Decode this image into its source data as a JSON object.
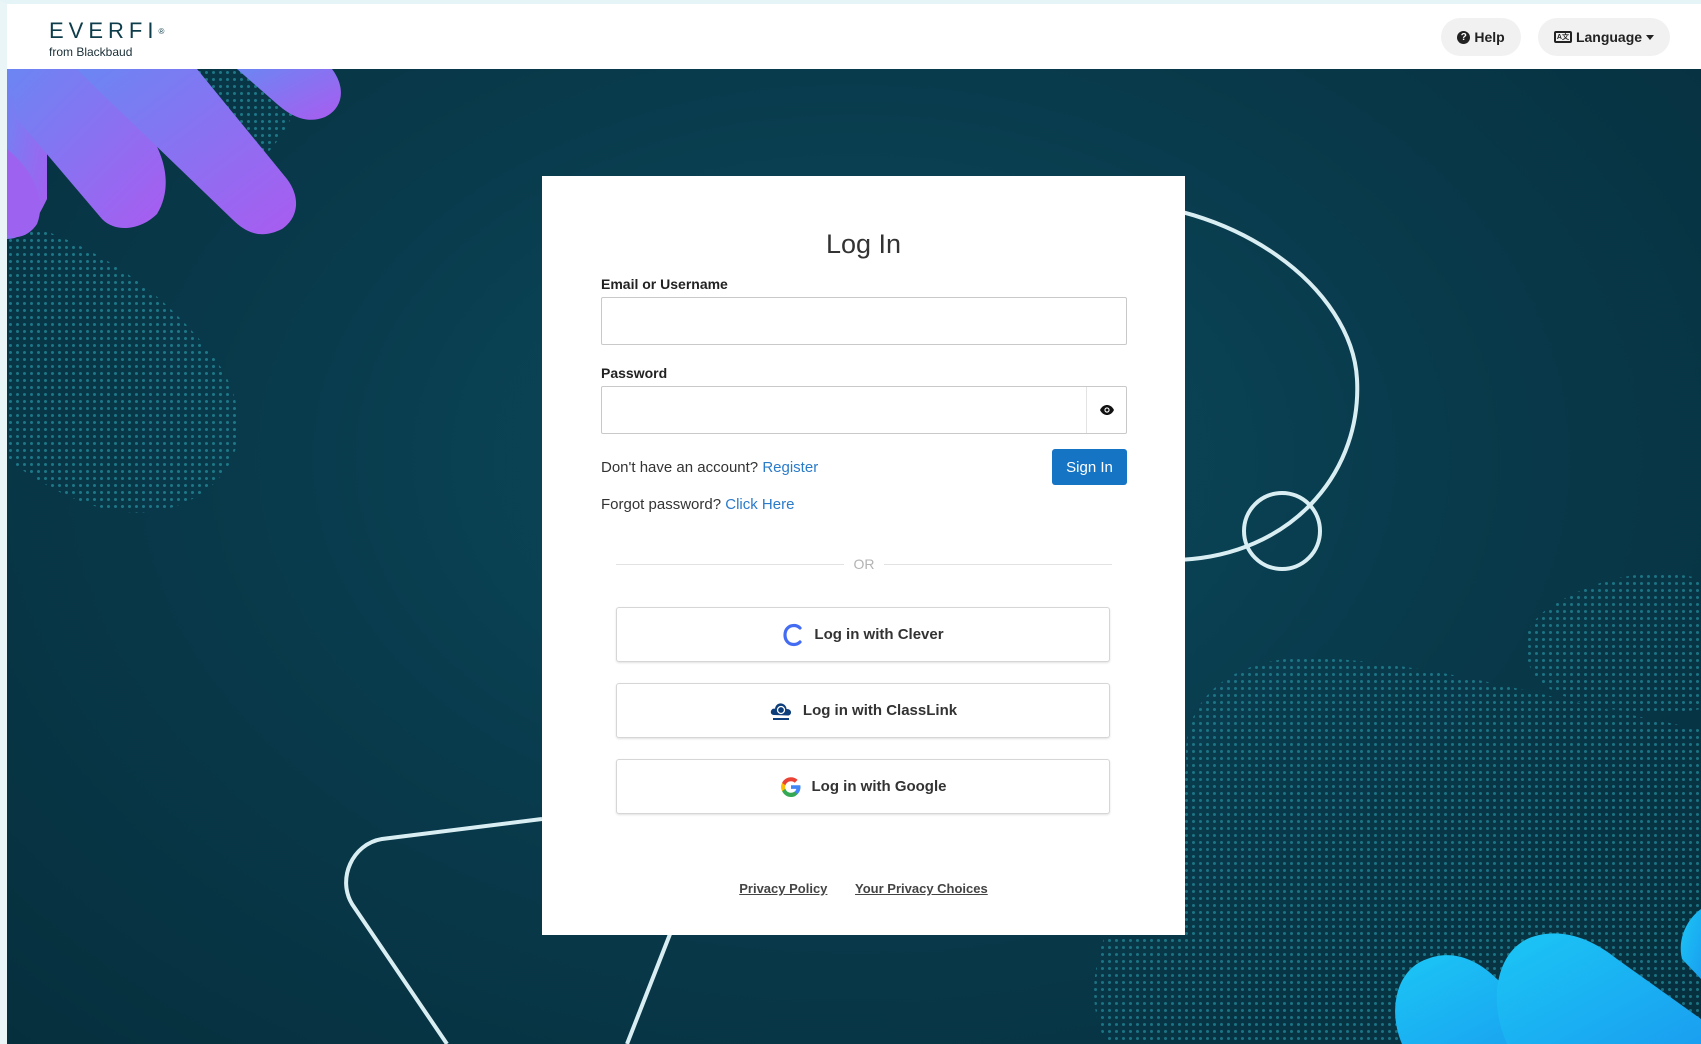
{
  "header": {
    "logo_main": "EVERFI",
    "logo_registered": "®",
    "logo_sub": "from Blackbaud",
    "help_label": "Help",
    "help_icon": "?",
    "language_label": "Language",
    "language_icon": "A文"
  },
  "login": {
    "title": "Log In",
    "email_label": "Email or Username",
    "email_value": "",
    "password_label": "Password",
    "password_value": "",
    "no_account_text": "Don't have an account?",
    "register_link": "Register",
    "sign_in_label": "Sign In",
    "forgot_text": "Forgot password?",
    "forgot_link": "Click Here",
    "or_text": "OR"
  },
  "sso": {
    "clever_label": "Log in with Clever",
    "classlink_label": "Log in with ClassLink",
    "google_label": "Log in with Google"
  },
  "footer": {
    "privacy_policy": "Privacy Policy",
    "privacy_choices": "Your Privacy Choices"
  },
  "colors": {
    "primary": "#1574c4",
    "link": "#2a7bc9",
    "background": "#08394a"
  }
}
